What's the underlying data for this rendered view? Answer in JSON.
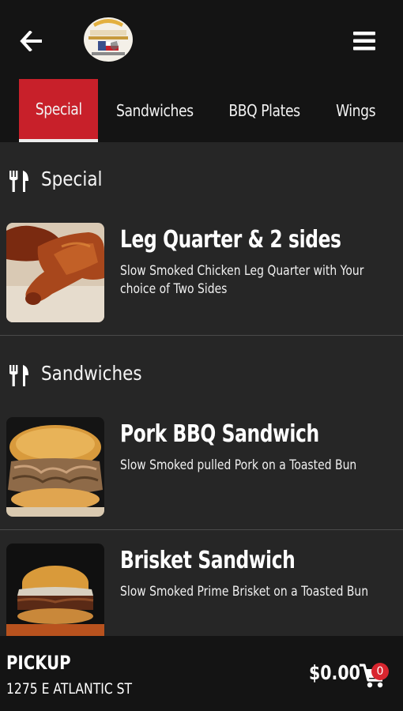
{
  "header": {
    "back_icon": "arrow-left-icon",
    "logo_icon": "texas-logo",
    "menu_icon": "hamburger-menu-icon"
  },
  "tabs": [
    {
      "label": "Special",
      "active": true
    },
    {
      "label": "Sandwiches",
      "active": false
    },
    {
      "label": "BBQ Plates",
      "active": false
    },
    {
      "label": "Wings",
      "active": false
    }
  ],
  "sections": [
    {
      "title": "Special",
      "icon": "fork-knife-icon",
      "items": [
        {
          "title": "Leg Quarter & 2 sides",
          "description": "Slow Smoked Chicken Leg Quarter with Your choice of Two Sides"
        }
      ]
    },
    {
      "title": "Sandwiches",
      "icon": "fork-knife-icon",
      "items": [
        {
          "title": "Pork BBQ Sandwich",
          "description": "Slow Smoked pulled Pork on a Toasted Bun"
        },
        {
          "title": "Brisket Sandwich",
          "description": "Slow Smoked Prime Brisket on a Toasted Bun"
        }
      ]
    }
  ],
  "footer": {
    "order_type": "PICKUP",
    "address": "1275 E ATLANTIC ST",
    "total": "$0.00",
    "cart_icon": "cart-icon",
    "cart_count": "0"
  },
  "colors": {
    "accent": "#c8202a",
    "bar_bg": "#141414",
    "content_bg": "#262626"
  }
}
